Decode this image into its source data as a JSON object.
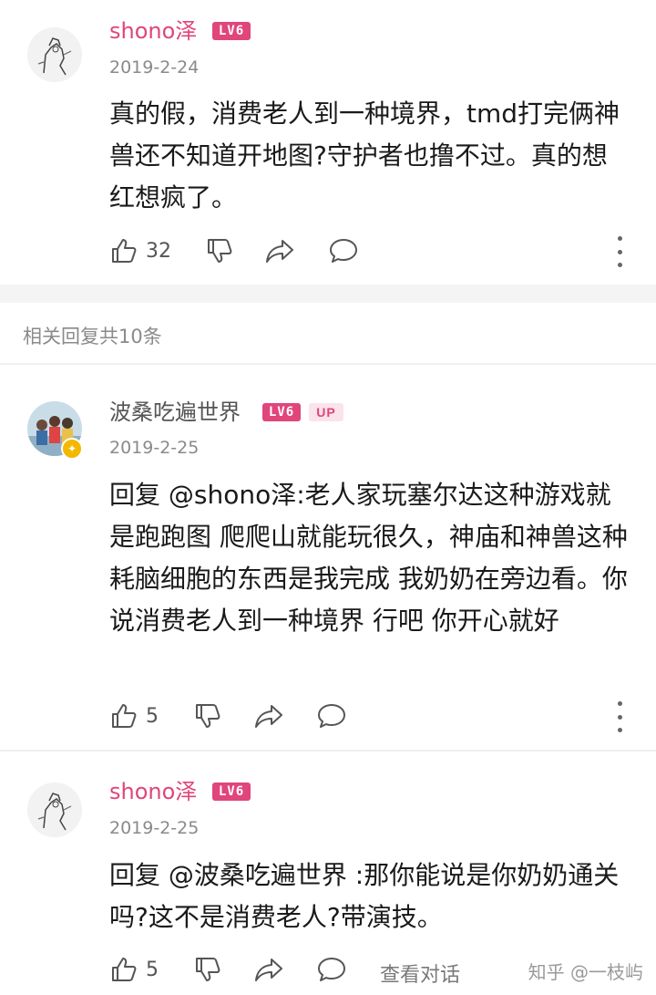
{
  "comments": [
    {
      "username": "shono泽",
      "level_badge": "LV6",
      "date": "2019-2-24",
      "text": "真的假，消费老人到一种境界，tmd打完俩神兽还不知道开地图?守护者也撸不过。真的想红想疯了。",
      "likes": "32"
    },
    {
      "username": "波桑吃遍世界",
      "level_badge": "LV6",
      "up_badge": "UP",
      "date": "2019-2-25",
      "text": "回复 @shono泽:老人家玩塞尔达这种游戏就是跑跑图 爬爬山就能玩很久，神庙和神兽这种耗脑细胞的东西是我完成 我奶奶在旁边看。你说消费老人到一种境界 行吧 你开心就好",
      "likes": "5"
    },
    {
      "username": "shono泽",
      "level_badge": "LV6",
      "date": "2019-2-25",
      "text": "回复 @波桑吃遍世界 :那你能说是你奶奶通关吗?这不是消费老人?带演技。",
      "likes": "5",
      "view_conversation": "查看对话"
    }
  ],
  "replies_header": "相关回复共10条",
  "watermark": "知乎 @一枝屿",
  "icons": [
    "like-icon",
    "dislike-icon",
    "share-icon",
    "comment-icon",
    "more-icon"
  ],
  "colors": {
    "accent": "#e0457b",
    "muted": "#8a8a8a"
  }
}
